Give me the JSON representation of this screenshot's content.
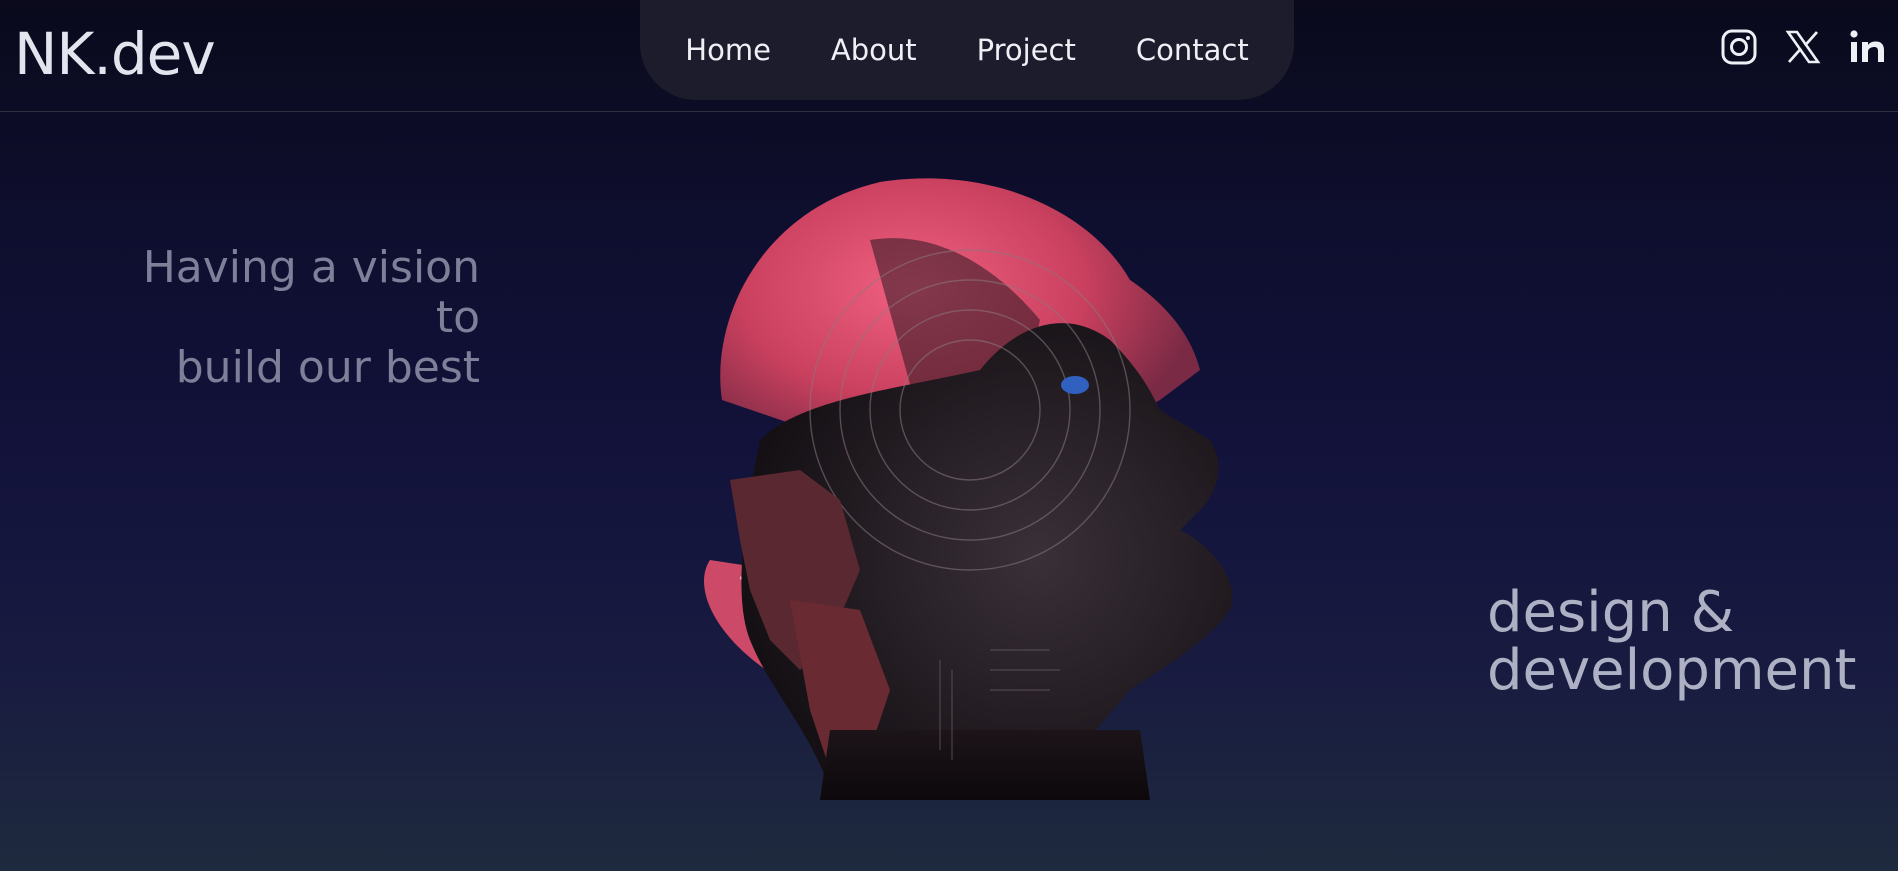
{
  "header": {
    "logo": "NK.dev",
    "nav": [
      "Home",
      "About",
      "Project",
      "Contact"
    ],
    "social": [
      "instagram-icon",
      "x-twitter-icon",
      "linkedin-icon"
    ]
  },
  "hero": {
    "tagline_left_line1": "Having a vision to",
    "tagline_left_line2": "build our best",
    "tagline_right_line1": "design &",
    "tagline_right_line2": "development"
  },
  "colors": {
    "accent_pink": "#e8506e",
    "background_top": "#0a0a1c",
    "background_bottom": "#1e2a3e",
    "nav_pill": "#1c1c2c"
  }
}
